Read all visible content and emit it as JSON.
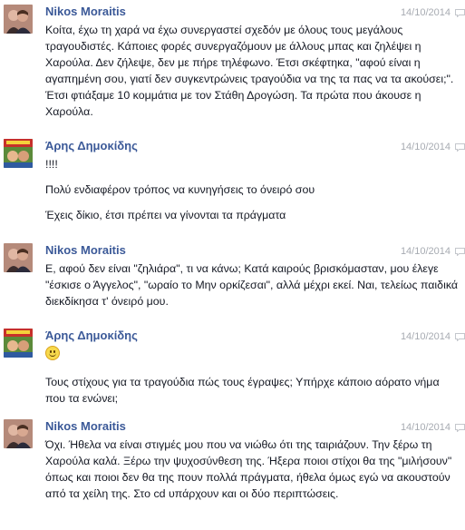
{
  "messages": [
    {
      "author": "Nikos Moraitis",
      "timestamp": "14/10/2014",
      "avatar": "nikos",
      "paragraphs": [
        "Κοίτα, έχω τη χαρά να έχω συνεργαστεί σχεδόν με όλους τους μεγάλους τραγουδιστές. Κάποιες φορές συνεργαζόμουν με άλλους μπας και ζηλέψει η Χαρούλα. Δεν ζήλεψε, δεν με πήρε τηλέφωνο. Έτσι σκέφτηκα, \"αφού είναι η αγαπημένη σου, γιατί δεν συγκεντρώνεις τραγούδια να της τα πας να τα ακούσει;\". Έτσι φτιάξαμε 10 κομμάτια με τον Στάθη Δρογώση. Τα πρώτα που άκουσε η Χαρούλα."
      ]
    },
    {
      "author": "Άρης Δημοκίδης",
      "timestamp": "14/10/2014",
      "avatar": "aris",
      "paragraphs": [
        "!!!!",
        "Πολύ ενδιαφέρον τρόπος να κυνηγήσεις το όνειρό σου",
        "Έχεις δίκιο, έτσι πρέπει να γίνονται τα πράγματα"
      ]
    },
    {
      "author": "Nikos Moraitis",
      "timestamp": "14/10/2014",
      "avatar": "nikos",
      "paragraphs": [
        "Ε, αφού δεν είναι \"ζηλιάρα\", τι να κάνω; Κατά καιρούς βρισκόμασταν, μου έλεγε \"έσκισε ο Άγγελος\", \"ωραίο το Μην ορκίζεσαι\", αλλά μέχρι εκεί. Ναι, τελείως παιδικά διεκδίκησα τ' όνειρό μου."
      ]
    },
    {
      "author": "Άρης Δημοκίδης",
      "timestamp": "14/10/2014",
      "avatar": "aris",
      "emoji": "smile-emoticon",
      "paragraphs": [
        "Τους στίχους για τα τραγούδια πώς τους έγραψες; Υπήρχε κάποιο αόρατο νήμα που τα ενώνει;"
      ]
    },
    {
      "author": "Nikos Moraitis",
      "timestamp": "14/10/2014",
      "avatar": "nikos",
      "paragraphs": [
        "Όχι. Ήθελα να είναι στιγμές μου που να νιώθω ότι της ταιριάζουν. Την ξέρω τη Χαρούλα καλά. Ξέρω την ψυχοσύνθεση της. Ήξερα ποιοι στίχοι θα της \"μιλήσουν\" όπως και ποιοι δεν θα της πουν πολλά πράγματα, ήθελα όμως εγώ να ακουστούν από τα χείλη της. Στο cd υπάρχουν και οι δύο περιπτώσεις."
      ]
    }
  ],
  "colors": {
    "name": "#3b5998",
    "text": "#141823",
    "meta": "#a7abb2"
  },
  "icons": {
    "message": "message-bubble-icon"
  }
}
